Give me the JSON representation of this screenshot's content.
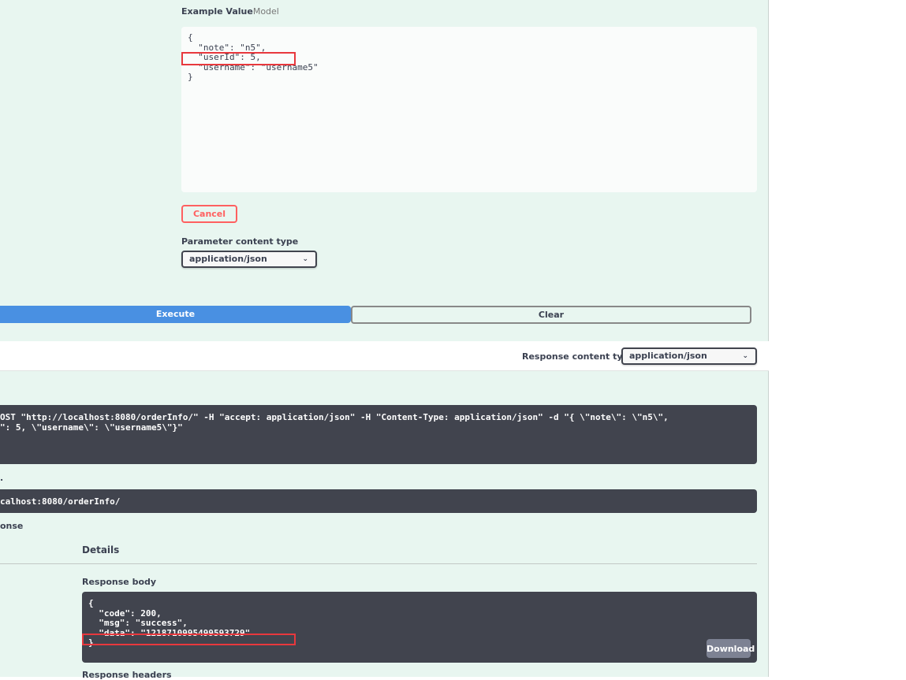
{
  "example": {
    "title": "Example Value",
    "model_tab": "Model",
    "lines": [
      "{",
      "  \"note\": \"n5\",",
      "  \"userId\": 5,",
      "  \"username\": \"username5\"",
      "}"
    ]
  },
  "cancel_label": "Cancel",
  "parameter_content_type": {
    "label": "Parameter content type",
    "value": "application/json"
  },
  "execute_label": "Execute",
  "clear_label": "Clear",
  "response_content_type": {
    "label": "Response content type",
    "value": "application/json"
  },
  "curl": {
    "lines": [
      "OST \"http://localhost:8080/orderInfo/\" -H \"accept: application/json\" -H \"Content-Type: application/json\" -d \"{ \\\"note\\\": \\\"n5\\\",",
      "\": 5, \\\"username\\\": \\\"username5\\\"}\""
    ]
  },
  "request_url": {
    "label_fragment": ".",
    "value": "calhost:8080/orderInfo/"
  },
  "server_response_fragment": "onse",
  "details_label": "Details",
  "response_body": {
    "label": "Response body",
    "lines": [
      "{",
      "  \"code\": 200,",
      "  \"msg\": \"success\",",
      "  \"data\": \"1218710995499593729\"",
      "}"
    ],
    "download_label": "Download"
  },
  "response_headers_label": "Response headers",
  "highlight_color": "#e8383d",
  "execute_color": "#4990e2"
}
